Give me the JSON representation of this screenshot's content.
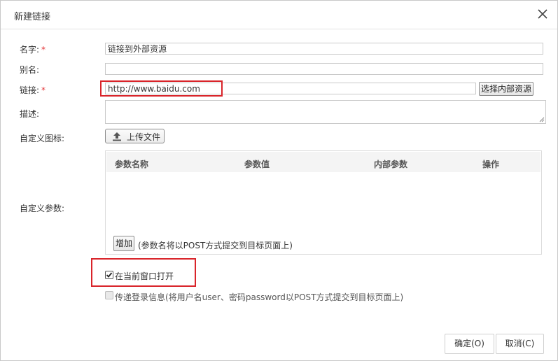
{
  "dialog": {
    "title": "新建链接",
    "close_icon": "close-icon"
  },
  "form": {
    "name": {
      "label": "名字:",
      "required_mark": "*",
      "value": "链接到外部资源"
    },
    "alias": {
      "label": "别名:",
      "value": ""
    },
    "link": {
      "label": "链接:",
      "required_mark": "*",
      "value": "http://www.baidu.com",
      "choose_button": "选择内部资源"
    },
    "description": {
      "label": "描述:",
      "value": ""
    },
    "icon": {
      "label": "自定义图标:",
      "upload_button": "上传文件",
      "upload_icon": "upload-icon"
    },
    "params": {
      "label": "自定义参数:",
      "columns": [
        "参数名称",
        "参数值",
        "内部参数",
        "操作"
      ],
      "add_button": "增加",
      "hint": "(参数名将以POST方式提交到目标页面上)"
    },
    "open_current_window": {
      "label": "在当前窗口打开",
      "checked": true
    },
    "pass_login": {
      "label": "传递登录信息(将用户名user、密码password以POST方式提交到目标页面上)",
      "checked": false,
      "disabled": true
    }
  },
  "footer": {
    "ok": "确定(O)",
    "cancel": "取消(C)"
  },
  "colors": {
    "highlight": "#d9242a",
    "required": "#e4393c"
  }
}
